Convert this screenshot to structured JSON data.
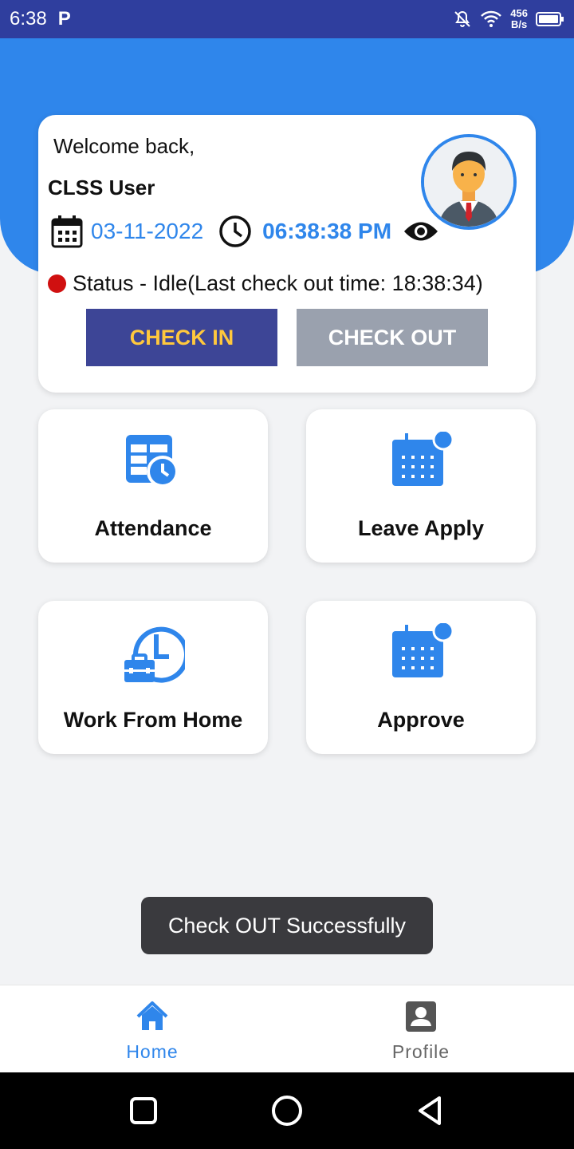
{
  "statusbar": {
    "time": "6:38",
    "carrier_icon": "P",
    "speed_value": "456",
    "speed_unit": "B/s"
  },
  "card": {
    "welcome": "Welcome back,",
    "username": "CLSS User",
    "date": "03-11-2022",
    "time": "06:38:38 PM",
    "status": "Status - Idle(Last check out time: 18:38:34)",
    "status_color": "#d01010",
    "check_in_label": "CHECK IN",
    "check_out_label": "CHECK OUT"
  },
  "tiles": [
    {
      "label": "Attendance",
      "icon": "attendance-icon"
    },
    {
      "label": "Leave Apply",
      "icon": "calendar-icon"
    },
    {
      "label": "Work From Home",
      "icon": "work-from-home-icon"
    },
    {
      "label": "Approve",
      "icon": "calendar-icon"
    }
  ],
  "toast": {
    "message": "Check OUT Successfully"
  },
  "bottom_nav": {
    "home_label": "Home",
    "profile_label": "Profile"
  },
  "colors": {
    "accent": "#2f86eb",
    "status_bar": "#2f3e9e",
    "check_in_bg": "#3d4596",
    "check_in_text": "#ffc83d",
    "check_out_bg": "#9aa1ae"
  }
}
